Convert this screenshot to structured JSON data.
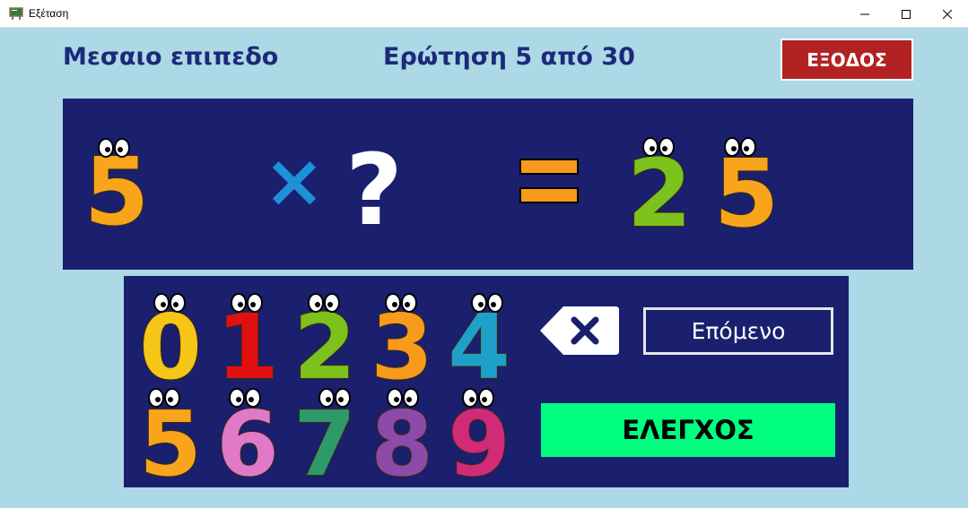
{
  "window": {
    "title": "Εξέταση"
  },
  "header": {
    "level": "Μεσαιο επιπεδο",
    "question": "Ερώτηση 5 από 30",
    "exit_label": "ΕΞΟΔΟΣ"
  },
  "equation": {
    "operand": "5",
    "operator": "×",
    "unknown": "?",
    "equals": "=",
    "result_digits": [
      "2",
      "5"
    ]
  },
  "keypad": {
    "digits": [
      "0",
      "1",
      "2",
      "3",
      "4",
      "5",
      "6",
      "7",
      "8",
      "9"
    ],
    "digit_colors": [
      "#f5c518",
      "#e01010",
      "#7cc21c",
      "#f89a1c",
      "#1ea0c8",
      "#f8a51c",
      "#e07ac8",
      "#2e9a6a",
      "#8e4aa8",
      "#d02a78"
    ],
    "backspace_icon": "backspace-icon",
    "next_label": "Επόμενο",
    "check_label": "ΕΛΕΓΧΟΣ"
  },
  "colors": {
    "background": "#add8e6",
    "panel": "#1a1f6e",
    "exit": "#b22222",
    "check": "#00ff80",
    "equation_digits": "#f8a51c",
    "equation_two": "#7cc21c",
    "operator": "#1e90d8"
  }
}
